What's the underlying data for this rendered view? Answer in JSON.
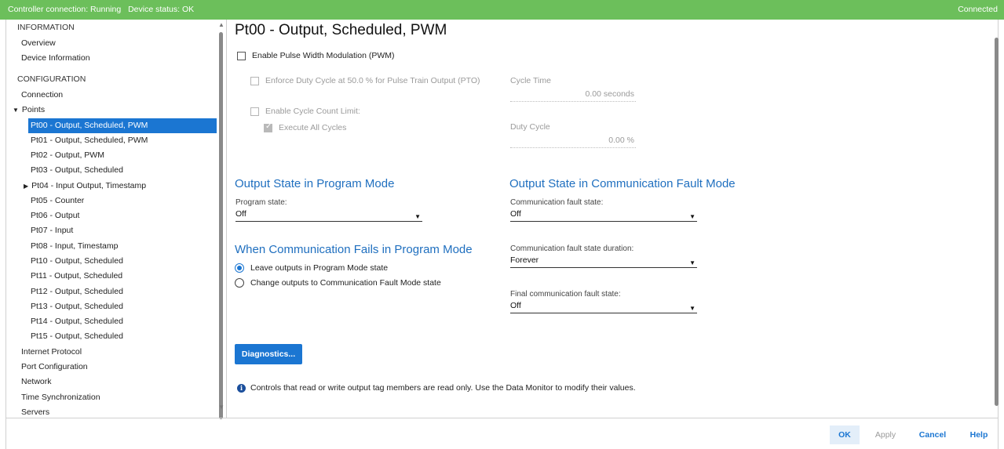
{
  "status_bar": {
    "controller": "Controller connection: Running",
    "device": "Device status: OK",
    "connection": "Connected"
  },
  "sidebar": {
    "items": [
      {
        "label": "INFORMATION"
      },
      {
        "label": "Overview"
      },
      {
        "label": "Device Information"
      },
      {
        "label": "CONFIGURATION"
      },
      {
        "label": "Connection"
      },
      {
        "label": "Points",
        "expanded": true
      },
      {
        "label": "Pt00 - Output, Scheduled, PWM",
        "selected": true
      },
      {
        "label": "Pt01 - Output, Scheduled, PWM"
      },
      {
        "label": "Pt02 - Output, PWM"
      },
      {
        "label": "Pt03 - Output, Scheduled"
      },
      {
        "label": "Pt04 - Input Output, Timestamp",
        "expanded": false
      },
      {
        "label": "Pt05 - Counter"
      },
      {
        "label": "Pt06 - Output"
      },
      {
        "label": "Pt07 - Input"
      },
      {
        "label": "Pt08 - Input, Timestamp"
      },
      {
        "label": "Pt10 - Output, Scheduled"
      },
      {
        "label": "Pt11 - Output, Scheduled"
      },
      {
        "label": "Pt12 - Output, Scheduled"
      },
      {
        "label": "Pt13 - Output, Scheduled"
      },
      {
        "label": "Pt14 - Output, Scheduled"
      },
      {
        "label": "Pt15 - Output, Scheduled"
      },
      {
        "label": "Internet Protocol"
      },
      {
        "label": "Port Configuration"
      },
      {
        "label": "Network"
      },
      {
        "label": "Time Synchronization"
      },
      {
        "label": "Servers"
      }
    ]
  },
  "main": {
    "title": "Pt00 - Output, Scheduled, PWM",
    "pwm": {
      "enable_label": "Enable Pulse Width Modulation (PWM)",
      "enable_checked": false,
      "enforce_label": "Enforce Duty Cycle at 50.0 % for Pulse Train Output (PTO)",
      "cycle_limit_label": "Enable Cycle Count Limit:",
      "execute_all_label": "Execute All Cycles",
      "execute_all_checked": true,
      "cycle_time_label": "Cycle Time",
      "cycle_time_value": "0.00 seconds",
      "duty_cycle_label": "Duty Cycle",
      "duty_cycle_value": "0.00 %"
    },
    "program_mode": {
      "title": "Output State in Program Mode",
      "state_label": "Program state:",
      "state_value": "Off"
    },
    "comm_fails": {
      "title": "When Communication Fails in Program Mode",
      "option1": "Leave outputs in Program Mode state",
      "option2": "Change outputs to Communication Fault Mode state",
      "selected": 1
    },
    "fault_mode": {
      "title": "Output State in Communication Fault Mode",
      "state_label": "Communication fault state:",
      "state_value": "Off",
      "duration_label": "Communication fault state duration:",
      "duration_value": "Forever",
      "final_label": "Final communication fault state:",
      "final_value": "Off"
    },
    "diagnostics_label": "Diagnostics...",
    "info_text": "Controls that read or write output tag members are read only. Use the Data Monitor to modify their values."
  },
  "footer": {
    "ok": "OK",
    "apply": "Apply",
    "cancel": "Cancel",
    "help": "Help"
  },
  "colors": {
    "status_green": "#6cbf5b",
    "accent_blue": "#1b76d2",
    "section_blue": "#1f6fbf"
  }
}
